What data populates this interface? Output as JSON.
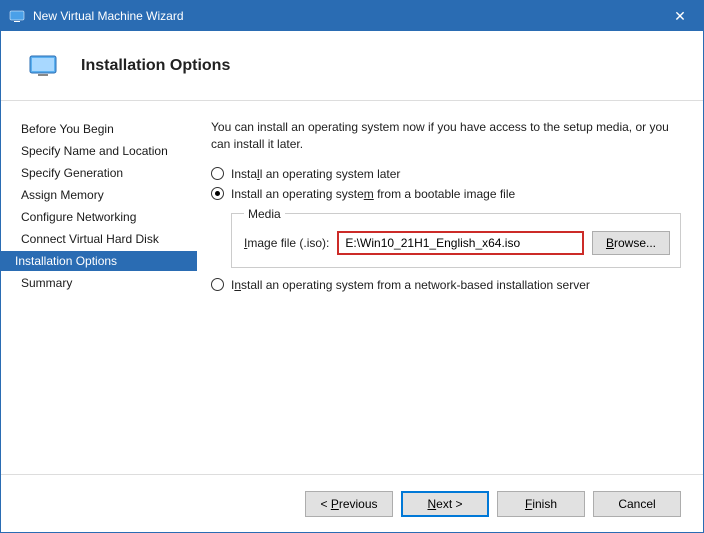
{
  "window": {
    "title": "New Virtual Machine Wizard",
    "close_glyph": "✕"
  },
  "header": {
    "title": "Installation Options"
  },
  "sidebar": {
    "items": [
      {
        "label": "Before You Begin"
      },
      {
        "label": "Specify Name and Location"
      },
      {
        "label": "Specify Generation"
      },
      {
        "label": "Assign Memory"
      },
      {
        "label": "Configure Networking"
      },
      {
        "label": "Connect Virtual Hard Disk"
      },
      {
        "label": "Installation Options"
      },
      {
        "label": "Summary"
      }
    ],
    "selected_index": 6
  },
  "content": {
    "description": "You can install an operating system now if you have access to the setup media, or you can install it later.",
    "option_later": "Install an operating system later",
    "option_image": "Install an operating system from a bootable image file",
    "option_network": "Install an operating system from a network-based installation server",
    "media_legend": "Media",
    "image_file_label": "Image file (.iso):",
    "image_file_value": "E:\\Win10_21H1_English_x64.iso",
    "browse_label": "Browse..."
  },
  "footer": {
    "previous": "< Previous",
    "next": "Next >",
    "finish": "Finish",
    "cancel": "Cancel"
  }
}
